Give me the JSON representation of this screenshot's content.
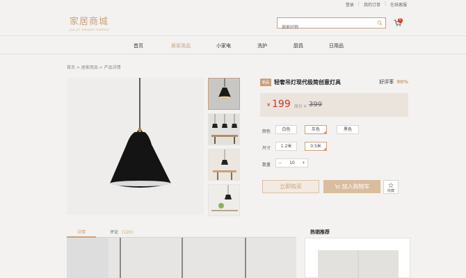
{
  "top_links": [
    "登录",
    "我的订单",
    "在线客服"
  ],
  "logo": {
    "cn": "家居商城",
    "en": "JIA JU SHANG CHENG"
  },
  "search": {
    "placeholder": "搜索好物"
  },
  "cart": {
    "badge": "0"
  },
  "nav": [
    "首页",
    "居家用品",
    "小家电",
    "洗护",
    "厨具",
    "日用品"
  ],
  "nav_active": "居家用品",
  "breadcrumb": "首页 > 居家用品 > 产品详情",
  "product": {
    "tag": "新品",
    "title": "轻奢吊灯现代极简创意灯具",
    "rating_label": "好评率",
    "rating_value": "90%",
    "currency": "¥",
    "price": "199",
    "orig_label": "原价 ¥",
    "orig_price": "399",
    "color_label": "颜色",
    "colors": [
      "白色",
      "灰色",
      "黑色"
    ],
    "color_selected": "灰色",
    "size_label": "尺寸",
    "sizes": [
      "1.2米",
      "0.5米"
    ],
    "size_selected": "0.5米",
    "qty_label": "数量",
    "qty_minus": "−",
    "qty_value": "10",
    "qty_plus": "+",
    "buy_label": "立即购买",
    "cart_label": "加入购物车",
    "fav_label": "收藏"
  },
  "tabs": {
    "detail": "详情",
    "reviews": "评论",
    "review_count": "(120)"
  },
  "hot_title": "热销推荐",
  "colors": {
    "accent": "#c9a27b",
    "price": "#d0341f",
    "bg": "#f3f2f0"
  }
}
